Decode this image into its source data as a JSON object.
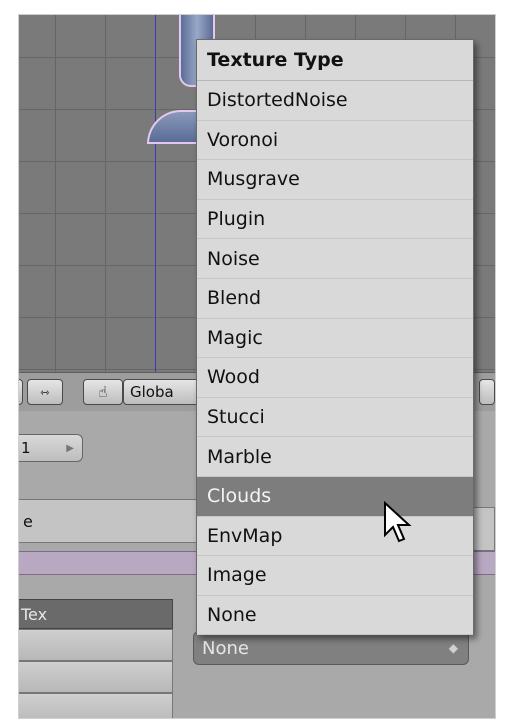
{
  "menu": {
    "title": "Texture Type",
    "items": [
      "DistortedNoise",
      "Voronoi",
      "Musgrave",
      "Plugin",
      "Noise",
      "Blend",
      "Magic",
      "Wood",
      "Stucci",
      "Marble",
      "Clouds",
      "EnvMap",
      "Image",
      "None"
    ],
    "highlighted": "Clouds"
  },
  "header": {
    "orientation_label": "Globa"
  },
  "props": {
    "channel_value": "1",
    "tab_label": "e",
    "tex_tab_label": "Tex",
    "type_select_value": "None"
  },
  "colors": {
    "highlight": "#7d7d7d",
    "menu_bg": "#d9d9d9",
    "selection_line": "#3b3bb0"
  }
}
